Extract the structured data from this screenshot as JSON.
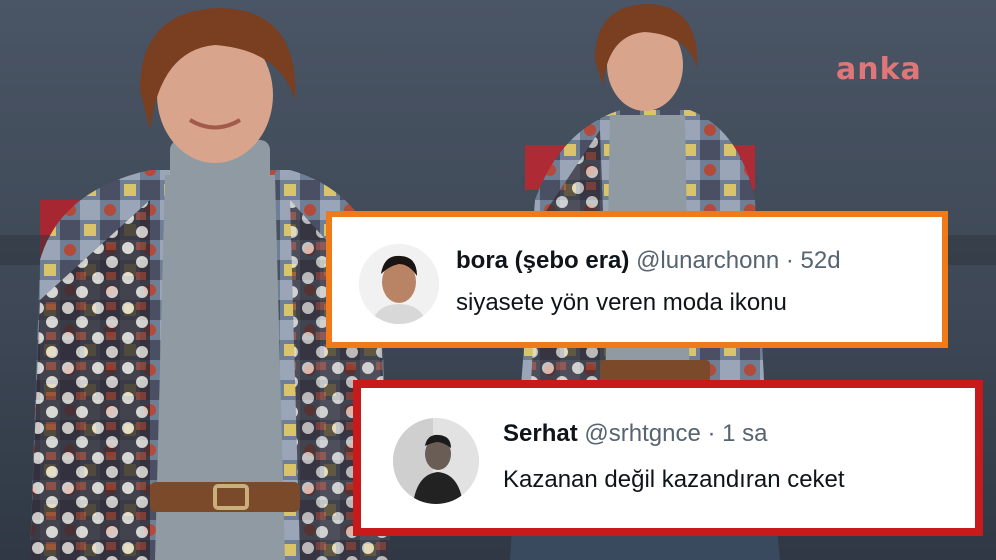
{
  "watermark": {
    "text": "anka"
  },
  "tweets": [
    {
      "display_name": "bora (şebo era)",
      "handle": "@lunarchonn",
      "separator": "·",
      "time": "52d",
      "text": "siyasete yön veren moda ikonu",
      "border_color": "#ee7a1a"
    },
    {
      "display_name": "Serhat",
      "handle": "@srhtgnce",
      "separator": "·",
      "time": "1 sa",
      "text": "Kazanan değil kazandıran ceket",
      "border_color": "#c81a1a"
    }
  ],
  "colors": {
    "background": "#3f4a58",
    "accent_red": "#c9222a"
  },
  "icons": [
    "avatar-photo"
  ]
}
